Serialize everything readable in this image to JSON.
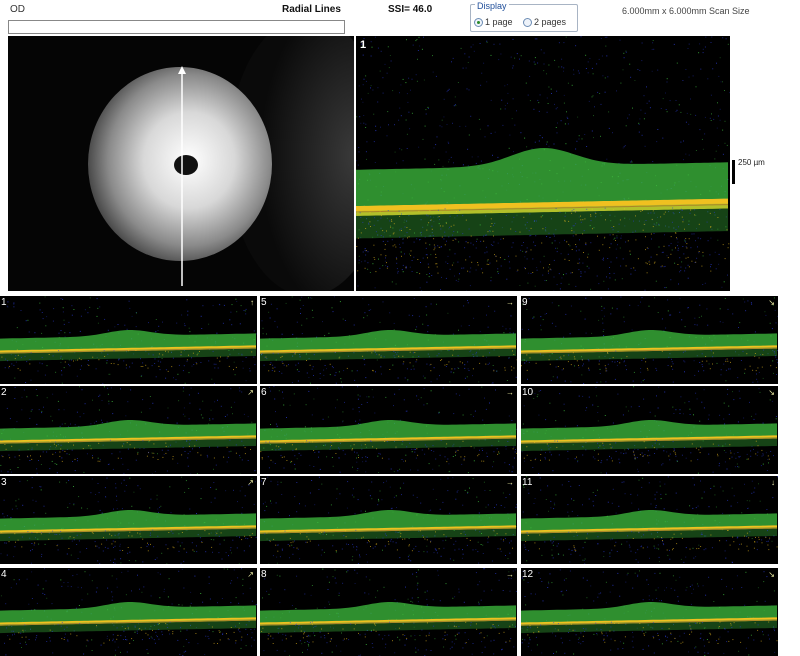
{
  "header": {
    "eye": "OD",
    "scan_type": "Radial Lines",
    "ssi": "SSI= 46.0",
    "display_legend": "Display",
    "radio_1": "1 page",
    "radio_2": "2 pages",
    "scan_size": "6.000mm x 6.000mm Scan Size"
  },
  "main_scan": {
    "label": "1",
    "scale": "250 µm"
  },
  "tiles": [
    {
      "label": "1",
      "dir": "↑"
    },
    {
      "label": "5",
      "dir": "→"
    },
    {
      "label": "9",
      "dir": "↘"
    },
    {
      "label": "2",
      "dir": "↗"
    },
    {
      "label": "6",
      "dir": "→"
    },
    {
      "label": "10",
      "dir": "↘"
    },
    {
      "label": "3",
      "dir": "↗"
    },
    {
      "label": "7",
      "dir": "→"
    },
    {
      "label": "11",
      "dir": "↓"
    },
    {
      "label": "4",
      "dir": "↗"
    },
    {
      "label": "8",
      "dir": "→"
    },
    {
      "label": "12",
      "dir": "↘"
    }
  ],
  "colors": {
    "retina_green": "#3fbf3f",
    "rpe_yellow": "#f0c020",
    "rpe_red": "#e0401a",
    "noise": "#2a3ad0"
  }
}
